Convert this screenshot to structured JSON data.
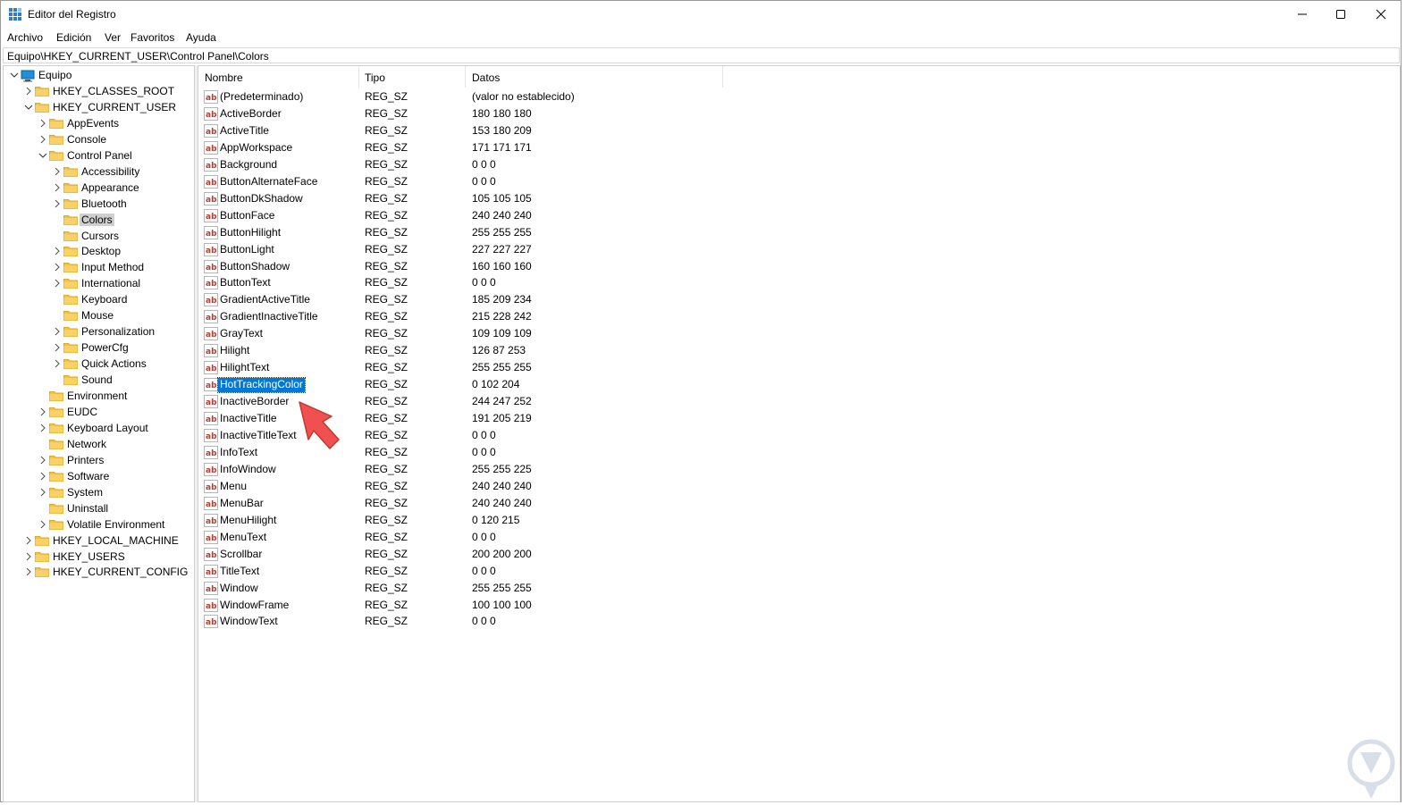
{
  "window": {
    "title": "Editor del Registro",
    "minimize_label": "Minimizar",
    "maximize_label": "Maximizar",
    "close_label": "Cerrar"
  },
  "menu": [
    "Archivo",
    "Edición",
    "Ver",
    "Favoritos",
    "Ayuda"
  ],
  "address": "Equipo\\HKEY_CURRENT_USER\\Control Panel\\Colors",
  "tree": [
    {
      "label": "Equipo",
      "level": 0,
      "chevron": "down",
      "icon": "computer"
    },
    {
      "label": "HKEY_CLASSES_ROOT",
      "level": 1,
      "chevron": "right"
    },
    {
      "label": "HKEY_CURRENT_USER",
      "level": 1,
      "chevron": "down"
    },
    {
      "label": "AppEvents",
      "level": 2,
      "chevron": "right"
    },
    {
      "label": "Console",
      "level": 2,
      "chevron": "right"
    },
    {
      "label": "Control Panel",
      "level": 2,
      "chevron": "down"
    },
    {
      "label": "Accessibility",
      "level": 3,
      "chevron": "right"
    },
    {
      "label": "Appearance",
      "level": 3,
      "chevron": "right"
    },
    {
      "label": "Bluetooth",
      "level": 3,
      "chevron": "right"
    },
    {
      "label": "Colors",
      "level": 3,
      "chevron": "none",
      "selected": true
    },
    {
      "label": "Cursors",
      "level": 3,
      "chevron": "none"
    },
    {
      "label": "Desktop",
      "level": 3,
      "chevron": "right"
    },
    {
      "label": "Input Method",
      "level": 3,
      "chevron": "right"
    },
    {
      "label": "International",
      "level": 3,
      "chevron": "right"
    },
    {
      "label": "Keyboard",
      "level": 3,
      "chevron": "none"
    },
    {
      "label": "Mouse",
      "level": 3,
      "chevron": "none"
    },
    {
      "label": "Personalization",
      "level": 3,
      "chevron": "right"
    },
    {
      "label": "PowerCfg",
      "level": 3,
      "chevron": "right"
    },
    {
      "label": "Quick Actions",
      "level": 3,
      "chevron": "right"
    },
    {
      "label": "Sound",
      "level": 3,
      "chevron": "none"
    },
    {
      "label": "Environment",
      "level": 2,
      "chevron": "none"
    },
    {
      "label": "EUDC",
      "level": 2,
      "chevron": "right"
    },
    {
      "label": "Keyboard Layout",
      "level": 2,
      "chevron": "right"
    },
    {
      "label": "Network",
      "level": 2,
      "chevron": "none"
    },
    {
      "label": "Printers",
      "level": 2,
      "chevron": "right"
    },
    {
      "label": "Software",
      "level": 2,
      "chevron": "right"
    },
    {
      "label": "System",
      "level": 2,
      "chevron": "right"
    },
    {
      "label": "Uninstall",
      "level": 2,
      "chevron": "none"
    },
    {
      "label": "Volatile Environment",
      "level": 2,
      "chevron": "right"
    },
    {
      "label": "HKEY_LOCAL_MACHINE",
      "level": 1,
      "chevron": "right"
    },
    {
      "label": "HKEY_USERS",
      "level": 1,
      "chevron": "right"
    },
    {
      "label": "HKEY_CURRENT_CONFIG",
      "level": 1,
      "chevron": "right"
    }
  ],
  "columns": [
    "Nombre",
    "Tipo",
    "Datos"
  ],
  "values": [
    {
      "name": "(Predeterminado)",
      "type": "REG_SZ",
      "data": "(valor no establecido)"
    },
    {
      "name": "ActiveBorder",
      "type": "REG_SZ",
      "data": "180 180 180"
    },
    {
      "name": "ActiveTitle",
      "type": "REG_SZ",
      "data": "153 180 209"
    },
    {
      "name": "AppWorkspace",
      "type": "REG_SZ",
      "data": "171 171 171"
    },
    {
      "name": "Background",
      "type": "REG_SZ",
      "data": "0 0 0"
    },
    {
      "name": "ButtonAlternateFace",
      "type": "REG_SZ",
      "data": "0 0 0"
    },
    {
      "name": "ButtonDkShadow",
      "type": "REG_SZ",
      "data": "105 105 105"
    },
    {
      "name": "ButtonFace",
      "type": "REG_SZ",
      "data": "240 240 240"
    },
    {
      "name": "ButtonHilight",
      "type": "REG_SZ",
      "data": "255 255 255"
    },
    {
      "name": "ButtonLight",
      "type": "REG_SZ",
      "data": "227 227 227"
    },
    {
      "name": "ButtonShadow",
      "type": "REG_SZ",
      "data": "160 160 160"
    },
    {
      "name": "ButtonText",
      "type": "REG_SZ",
      "data": "0 0 0"
    },
    {
      "name": "GradientActiveTitle",
      "type": "REG_SZ",
      "data": "185 209 234"
    },
    {
      "name": "GradientInactiveTitle",
      "type": "REG_SZ",
      "data": "215 228 242"
    },
    {
      "name": "GrayText",
      "type": "REG_SZ",
      "data": "109 109 109"
    },
    {
      "name": "Hilight",
      "type": "REG_SZ",
      "data": "126 87 253"
    },
    {
      "name": "HilightText",
      "type": "REG_SZ",
      "data": "255 255 255"
    },
    {
      "name": "HotTrackingColor",
      "type": "REG_SZ",
      "data": "0 102 204",
      "selected": true
    },
    {
      "name": "InactiveBorder",
      "type": "REG_SZ",
      "data": "244 247 252"
    },
    {
      "name": "InactiveTitle",
      "type": "REG_SZ",
      "data": "191 205 219"
    },
    {
      "name": "InactiveTitleText",
      "type": "REG_SZ",
      "data": "0 0 0"
    },
    {
      "name": "InfoText",
      "type": "REG_SZ",
      "data": "0 0 0"
    },
    {
      "name": "InfoWindow",
      "type": "REG_SZ",
      "data": "255 255 225"
    },
    {
      "name": "Menu",
      "type": "REG_SZ",
      "data": "240 240 240"
    },
    {
      "name": "MenuBar",
      "type": "REG_SZ",
      "data": "240 240 240"
    },
    {
      "name": "MenuHilight",
      "type": "REG_SZ",
      "data": "0 120 215"
    },
    {
      "name": "MenuText",
      "type": "REG_SZ",
      "data": "0 0 0"
    },
    {
      "name": "Scrollbar",
      "type": "REG_SZ",
      "data": "200 200 200"
    },
    {
      "name": "TitleText",
      "type": "REG_SZ",
      "data": "0 0 0"
    },
    {
      "name": "Window",
      "type": "REG_SZ",
      "data": "255 255 255"
    },
    {
      "name": "WindowFrame",
      "type": "REG_SZ",
      "data": "100 100 100"
    },
    {
      "name": "WindowText",
      "type": "REG_SZ",
      "data": "0 0 0"
    }
  ],
  "colors": {
    "selection": "#0078d7",
    "tree_selection": "#cfcfcf",
    "folder": "#f5c342",
    "folder_dark": "#e0a81c",
    "annotation_arrow": "#f0504f",
    "watermark": "#d9dfe8"
  },
  "icons": {
    "app": "regedit-icon",
    "value": "string-value-ab-icon",
    "folder": "folder-icon",
    "computer": "computer-icon",
    "annotation": "red-arrow-icon",
    "watermark": "solvetic-logo"
  }
}
